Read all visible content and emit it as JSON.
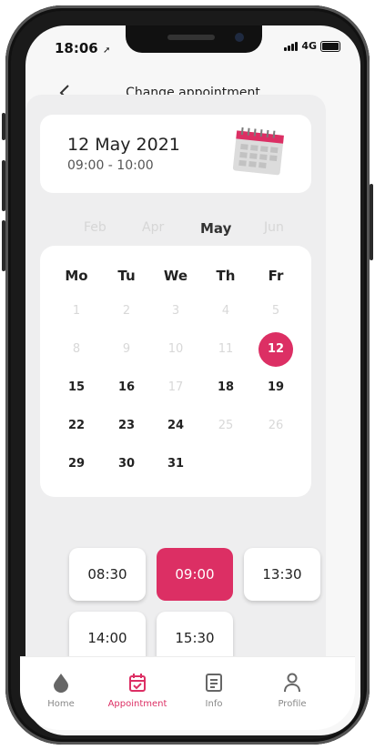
{
  "status_bar": {
    "time": "18:06",
    "network": "4G"
  },
  "header": {
    "title": "Change appointment"
  },
  "appointment": {
    "date": "12 May 2021",
    "time_range": "09:00 - 10:00"
  },
  "months": [
    {
      "label": "Feb",
      "active": false
    },
    {
      "label": "Apr",
      "active": false
    },
    {
      "label": "May",
      "active": true
    },
    {
      "label": "Jun",
      "active": false
    }
  ],
  "calendar": {
    "weekdays": [
      "Mo",
      "Tu",
      "We",
      "Th",
      "Fr"
    ],
    "weeks": [
      [
        {
          "d": "1",
          "state": "disabled"
        },
        {
          "d": "2",
          "state": "disabled"
        },
        {
          "d": "3",
          "state": "disabled"
        },
        {
          "d": "4",
          "state": "disabled"
        },
        {
          "d": "5",
          "state": "disabled"
        }
      ],
      [
        {
          "d": "8",
          "state": "disabled"
        },
        {
          "d": "9",
          "state": "disabled"
        },
        {
          "d": "10",
          "state": "disabled"
        },
        {
          "d": "11",
          "state": "disabled"
        },
        {
          "d": "12",
          "state": "selected"
        }
      ],
      [
        {
          "d": "15",
          "state": "available"
        },
        {
          "d": "16",
          "state": "available"
        },
        {
          "d": "17",
          "state": "disabled"
        },
        {
          "d": "18",
          "state": "available"
        },
        {
          "d": "19",
          "state": "available"
        }
      ],
      [
        {
          "d": "22",
          "state": "available"
        },
        {
          "d": "23",
          "state": "available"
        },
        {
          "d": "24",
          "state": "available"
        },
        {
          "d": "25",
          "state": "disabled"
        },
        {
          "d": "26",
          "state": "disabled"
        }
      ],
      [
        {
          "d": "29",
          "state": "available"
        },
        {
          "d": "30",
          "state": "available"
        },
        {
          "d": "31",
          "state": "available"
        }
      ]
    ]
  },
  "time_slots": [
    {
      "label": "08:30",
      "selected": false
    },
    {
      "label": "09:00",
      "selected": true
    },
    {
      "label": "13:30",
      "selected": false
    },
    {
      "label": "14:00",
      "selected": false
    },
    {
      "label": "15:30",
      "selected": false
    }
  ],
  "tabs": [
    {
      "label": "Home",
      "icon": "drop-icon",
      "active": false
    },
    {
      "label": "Appointment",
      "icon": "calendar-check-icon",
      "active": true
    },
    {
      "label": "Info",
      "icon": "document-icon",
      "active": false
    },
    {
      "label": "Profile",
      "icon": "user-icon",
      "active": false
    }
  ],
  "colors": {
    "accent": "#dc2f64",
    "background": "#f7f7f7",
    "panel": "#eeeeef"
  }
}
